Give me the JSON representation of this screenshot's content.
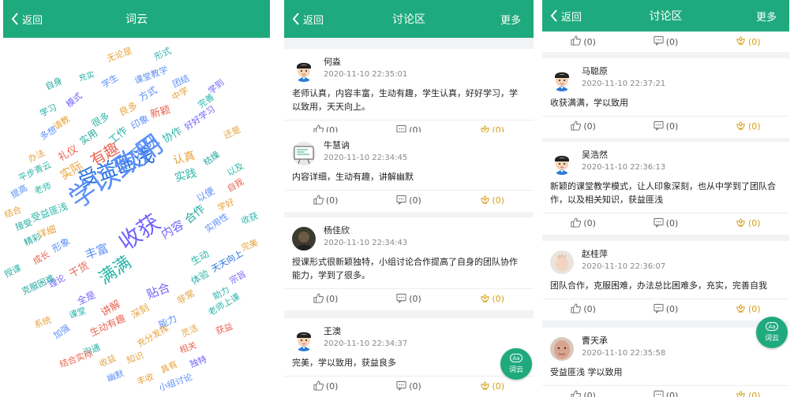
{
  "panel_wordcloud": {
    "back_label": "返回",
    "title": "词云",
    "words": [
      "无论是",
      "形式",
      "充实",
      "学生",
      "课堂教学",
      "自身",
      "团结",
      "学到",
      "模式",
      "方式",
      "中学",
      "完善",
      "学习",
      "良多",
      "新颖",
      "请教",
      "很多",
      "印象",
      "好好学习",
      "多想",
      "实用",
      "工作",
      "协作",
      "还是",
      "办法",
      "礼仪",
      "有趣",
      "团队",
      "认真",
      "枯燥",
      "平步青云",
      "实际",
      "以及",
      "提高",
      "老师",
      "受益匪浅",
      "实践",
      "自我",
      "结合",
      "以便",
      "学好",
      "接受",
      "受益匪浅",
      "详细",
      "学以致用",
      "合作",
      "实用性",
      "收获",
      "精彩",
      "形象",
      "内容",
      "完美",
      "授课",
      "成长",
      "丰富",
      "生动",
      "天天向上",
      "干货",
      "收获",
      "宗旨",
      "理论",
      "满满",
      "体验",
      "克服困难",
      "全是",
      "贴合",
      "非常",
      "助力",
      "课堂",
      "讲解",
      "系统",
      "深刻",
      "老师上课",
      "能力",
      "加强",
      "生动有趣",
      "灵活",
      "获益",
      "沟通",
      "充分发挥",
      "相关",
      "结合实际",
      "收益",
      "知识",
      "独特",
      "具有",
      "幽默",
      "丰收",
      "小组讨论"
    ]
  },
  "panel_discussion": {
    "back_label": "返回",
    "title": "讨论区",
    "more_label": "更多",
    "fab_label": "词云",
    "fab_icon_text": "Aa",
    "posts": [
      {
        "name": "何淼",
        "time": "2020-11-10 22:35:01",
        "text": "老师认真，内容丰富，生动有趣，学生认真，好好学习，学以致用，天天向上。",
        "like": "(0)",
        "comment": "(0)",
        "flower": "(0)",
        "avatar": "cartoon-boy"
      },
      {
        "name": "牛慧讷",
        "time": "2020-11-10 22:34:45",
        "text": "内容详细，生动有趣，讲解幽默",
        "like": "(0)",
        "comment": "(0)",
        "flower": "(0)",
        "avatar": "whiteboard"
      },
      {
        "name": "杨佳欣",
        "time": "2020-11-10 22:34:43",
        "text": "授课形式很新颖独特，小组讨论合作提高了自身的团队协作能力，学到了很多。",
        "like": "(0)",
        "comment": "(0)",
        "flower": "(0)",
        "avatar": "photo"
      },
      {
        "name": "王澳",
        "time": "2020-11-10 22:34:37",
        "text": "完美，学以致用，获益良多",
        "like": "(0)",
        "comment": "(0)",
        "flower": "(0)",
        "avatar": "cartoon-boy"
      }
    ]
  },
  "panel_discussion_scrolled": {
    "back_label": "返回",
    "title": "讨论区",
    "more_label": "更多",
    "fab_label": "词云",
    "fab_icon_text": "Aa",
    "top_actions": {
      "like": "(0)",
      "comment": "(0)",
      "flower": "(0)"
    },
    "posts": [
      {
        "name": "马聪原",
        "time": "2020-11-10 22:37:21",
        "text": "收获满满，学以致用",
        "like": "(0)",
        "comment": "(0)",
        "flower": "(0)",
        "avatar": "cartoon-boy"
      },
      {
        "name": "吴浩然",
        "time": "2020-11-10 22:36:13",
        "text": "新颖的课堂教学模式，让人印象深刻，也从中学到了团队合作，以及相关知识，获益匪浅",
        "like": "(0)",
        "comment": "(0)",
        "flower": "(0)",
        "avatar": "cartoon-boy"
      },
      {
        "name": "赵桂萍",
        "time": "2020-11-10 22:36:07",
        "text": "团队合作，克服困难，办法总比困难多，充实，完善自我",
        "like": "(0)",
        "comment": "(0)",
        "flower": "(0)",
        "avatar": "photo-hand"
      },
      {
        "name": "曹天承",
        "time": "2020-11-10 22:35:58",
        "text": "受益匪浅 学以致用",
        "like": "(0)",
        "comment": "(0)",
        "flower": "(0)",
        "avatar": "photo-face"
      }
    ]
  },
  "colors": {
    "brand": "#1faa7d",
    "flower": "#d4a017"
  }
}
